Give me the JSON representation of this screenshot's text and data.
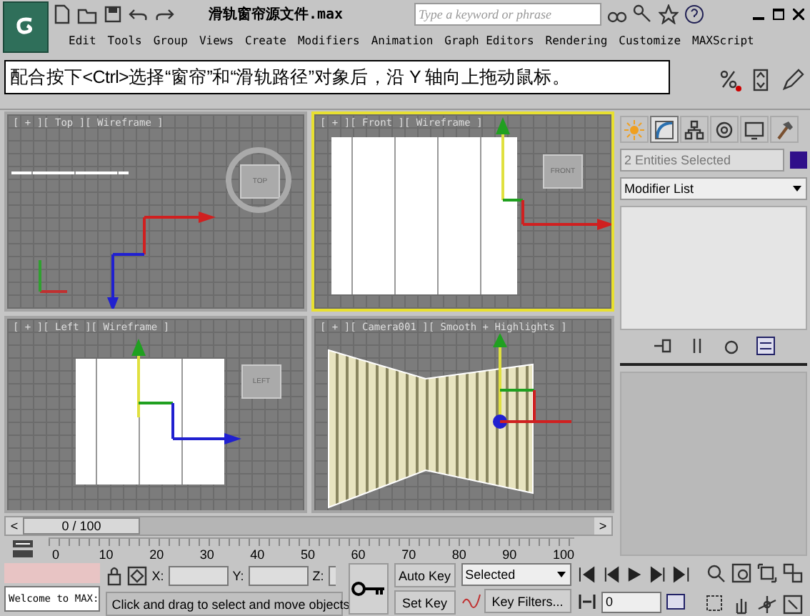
{
  "window": {
    "title": "滑轨窗帘源文件.max",
    "search_placeholder": "Type a keyword or phrase"
  },
  "menu": [
    "Edit",
    "Tools",
    "Group",
    "Views",
    "Create",
    "Modifiers",
    "Animation",
    "Graph Editors",
    "Rendering",
    "Customize",
    "MAXScript"
  ],
  "caption": "配合按下<Ctrl>选择“窗帘”和“滑轨路径”对象后，沿 Y 轴向上拖动鼠标。",
  "viewports": [
    {
      "kind": "top",
      "label": "[ + ][ Top ][ Wireframe ]",
      "cube": "TOP",
      "active": false
    },
    {
      "kind": "front",
      "label": "[ + ][ Front ][ Wireframe ]",
      "cube": "FRONT",
      "active": true
    },
    {
      "kind": "left",
      "label": "[ + ][ Left ][ Wireframe ]",
      "cube": "LEFT",
      "active": false
    },
    {
      "kind": "camera",
      "label": "[ + ][ Camera001 ][ Smooth + Highlights ]",
      "active": false
    }
  ],
  "command_panel": {
    "tabs": [
      {
        "kind": "create",
        "selected": false
      },
      {
        "kind": "modify",
        "selected": true
      },
      {
        "kind": "hierarchy",
        "selected": false
      },
      {
        "kind": "motion",
        "selected": false
      },
      {
        "kind": "display",
        "selected": false
      },
      {
        "kind": "utilities",
        "selected": false
      }
    ],
    "selection": "2 Entities Selected",
    "modifier_list": "Modifier List"
  },
  "time_slider": {
    "position": "0 / 100",
    "prev": "<",
    "next": ">",
    "ticks": [
      "0",
      "10",
      "20",
      "30",
      "40",
      "50",
      "60",
      "70",
      "80",
      "90",
      "100"
    ]
  },
  "status": {
    "welcome": "Welcome to MAX:",
    "x_label": "X:",
    "y_label": "Y:",
    "z_label": "Z:",
    "prompt": "Click and drag to select and move objects",
    "auto_key": "Auto Key",
    "set_key": "Set Key",
    "key_mode": "Selected",
    "key_filters": "Key Filters...",
    "frame": "0"
  }
}
